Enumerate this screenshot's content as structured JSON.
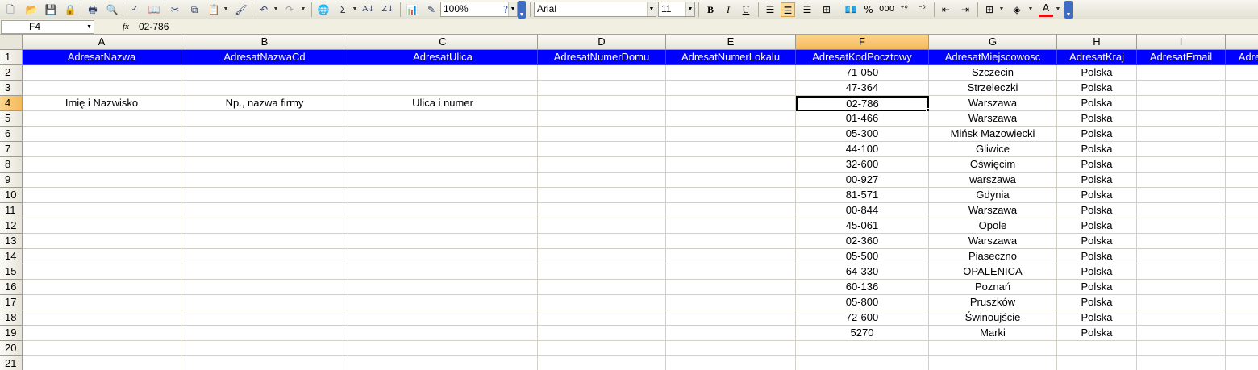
{
  "toolbar": {
    "zoom": "100%",
    "font_name": "Arial",
    "font_size": "11",
    "icons": [
      "new-icon",
      "open-icon",
      "save-icon",
      "permission-icon",
      "print-icon",
      "print-preview-icon",
      "spelling-icon",
      "research-icon",
      "cut-icon",
      "copy-icon",
      "paste-icon",
      "format-painter-icon",
      "undo-icon",
      "redo-icon",
      "hyperlink-icon",
      "autosum-icon",
      "sort-ascending-icon",
      "sort-descending-icon",
      "chart-wizard-icon",
      "drawing-icon",
      "help-icon",
      "bold-icon",
      "italic-icon",
      "underline-icon",
      "align-left-icon",
      "align-center-icon",
      "align-right-icon",
      "merge-center-icon",
      "currency-icon",
      "percent-icon",
      "comma-style-icon",
      "increase-decimal-icon",
      "decrease-decimal-icon",
      "decrease-indent-icon",
      "increase-indent-icon",
      "borders-icon",
      "fill-color-icon",
      "font-color-icon"
    ],
    "glyphs": {
      "bold": "B",
      "italic": "I",
      "underline": "U",
      "percent": "%",
      "comma": "000",
      "sigma": "Σ",
      "font_color": "A"
    },
    "accent_color": "#3f6cc3"
  },
  "formula_bar": {
    "name_box": "F4",
    "fx_label": "fx",
    "value": "02-786"
  },
  "sheet": {
    "columns": [
      "A",
      "B",
      "C",
      "D",
      "E",
      "F",
      "G",
      "H",
      "I"
    ],
    "selected_column": "F",
    "selected_row": "4",
    "header_fill_color": "#0000ff",
    "header_text_color": "#ffffff",
    "rows": [
      {
        "num": "1",
        "cells": [
          "AdresatNazwa",
          "AdresatNazwaCd",
          "AdresatUlica",
          "AdresatNumerDomu",
          "AdresatNumerLokalu",
          "AdresatKodPocztowy",
          "AdresatMiejscowosc",
          "AdresatKraj",
          "AdresatEmail",
          "Adre"
        ]
      },
      {
        "num": "2",
        "cells": [
          "",
          "",
          "",
          "",
          "",
          "71-050",
          "Szczecin",
          "Polska",
          "",
          ""
        ]
      },
      {
        "num": "3",
        "cells": [
          "",
          "",
          "",
          "",
          "",
          "47-364",
          "Strzeleczki",
          "Polska",
          "",
          ""
        ]
      },
      {
        "num": "4",
        "cells": [
          "Imię i Nazwisko",
          "Np., nazwa firmy",
          "Ulica i numer",
          "",
          "",
          "02-786",
          "Warszawa",
          "Polska",
          "",
          ""
        ]
      },
      {
        "num": "5",
        "cells": [
          "",
          "",
          "",
          "",
          "",
          "01-466",
          "Warszawa",
          "Polska",
          "",
          ""
        ]
      },
      {
        "num": "6",
        "cells": [
          "",
          "",
          "",
          "",
          "",
          "05-300",
          "Mińsk Mazowiecki",
          "Polska",
          "",
          ""
        ]
      },
      {
        "num": "7",
        "cells": [
          "",
          "",
          "",
          "",
          "",
          "44-100",
          "Gliwice",
          "Polska",
          "",
          ""
        ]
      },
      {
        "num": "8",
        "cells": [
          "",
          "",
          "",
          "",
          "",
          "32-600",
          "Oświęcim",
          "Polska",
          "",
          ""
        ]
      },
      {
        "num": "9",
        "cells": [
          "",
          "",
          "",
          "",
          "",
          "00-927",
          "warszawa",
          "Polska",
          "",
          ""
        ]
      },
      {
        "num": "10",
        "cells": [
          "",
          "",
          "",
          "",
          "",
          "81-571",
          "Gdynia",
          "Polska",
          "",
          ""
        ]
      },
      {
        "num": "11",
        "cells": [
          "",
          "",
          "",
          "",
          "",
          "00-844",
          "Warszawa",
          "Polska",
          "",
          ""
        ]
      },
      {
        "num": "12",
        "cells": [
          "",
          "",
          "",
          "",
          "",
          "45-061",
          "Opole",
          "Polska",
          "",
          ""
        ]
      },
      {
        "num": "13",
        "cells": [
          "",
          "",
          "",
          "",
          "",
          "02-360",
          "Warszawa",
          "Polska",
          "",
          ""
        ]
      },
      {
        "num": "14",
        "cells": [
          "",
          "",
          "",
          "",
          "",
          "05-500",
          "Piaseczno",
          "Polska",
          "",
          ""
        ]
      },
      {
        "num": "15",
        "cells": [
          "",
          "",
          "",
          "",
          "",
          "64-330",
          "OPALENICA",
          "Polska",
          "",
          ""
        ]
      },
      {
        "num": "16",
        "cells": [
          "",
          "",
          "",
          "",
          "",
          "60-136",
          "Poznań",
          "Polska",
          "",
          ""
        ]
      },
      {
        "num": "17",
        "cells": [
          "",
          "",
          "",
          "",
          "",
          "05-800",
          "Pruszków",
          "Polska",
          "",
          ""
        ]
      },
      {
        "num": "18",
        "cells": [
          "",
          "",
          "",
          "",
          "",
          "72-600",
          "Świnoujście",
          "Polska",
          "",
          ""
        ]
      },
      {
        "num": "19",
        "cells": [
          "",
          "",
          "",
          "",
          "",
          "5270",
          "Marki",
          "Polska",
          "",
          ""
        ]
      },
      {
        "num": "20",
        "cells": [
          "",
          "",
          "",
          "",
          "",
          "",
          "",
          "",
          "",
          ""
        ]
      },
      {
        "num": "21",
        "cells": [
          "",
          "",
          "",
          "",
          "",
          "",
          "",
          "",
          "",
          ""
        ]
      }
    ]
  }
}
